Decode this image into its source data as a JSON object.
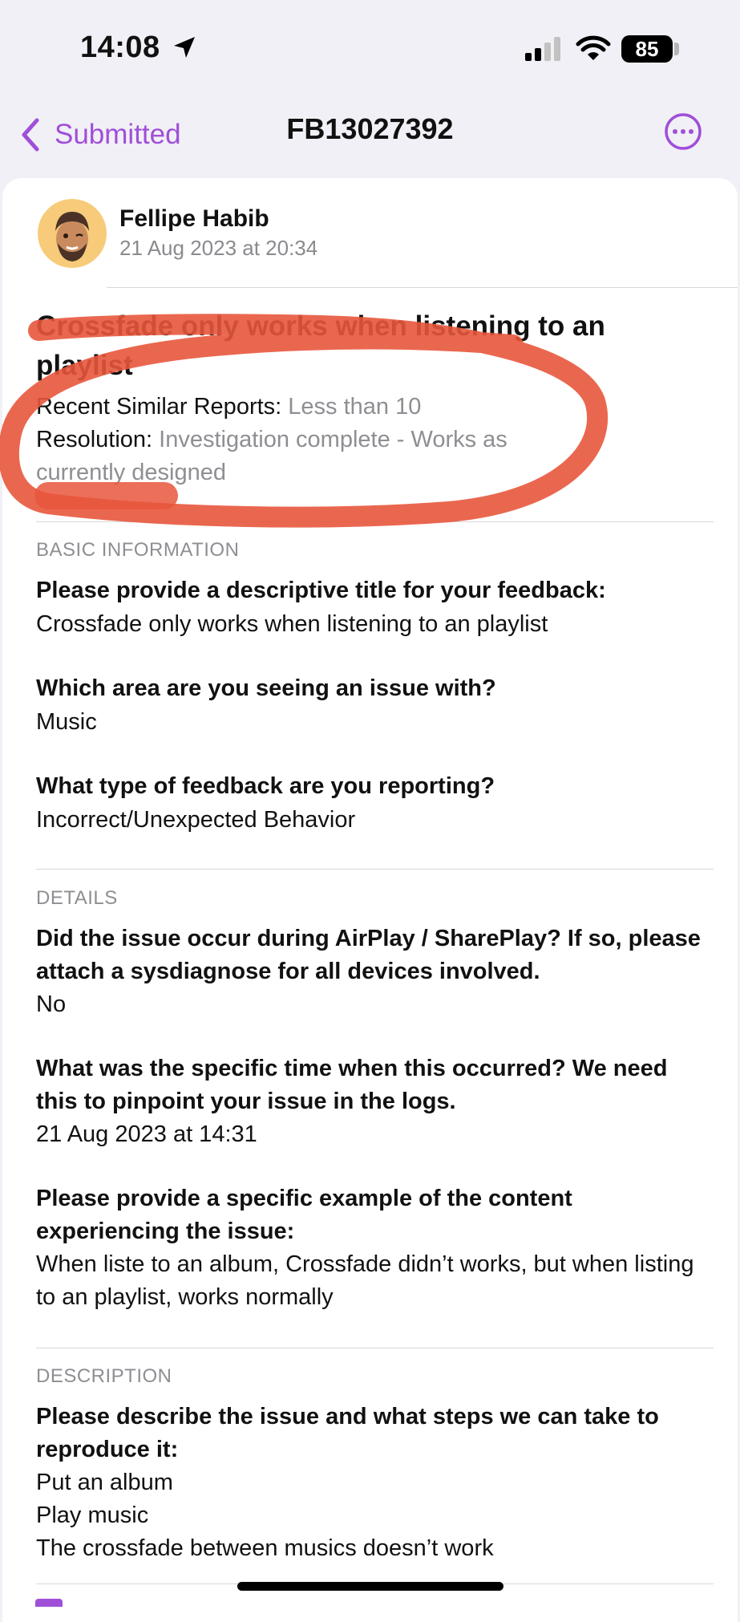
{
  "status_bar": {
    "time": "14:08",
    "battery": "85"
  },
  "nav": {
    "back_label": "Submitted",
    "title": "FB13027392"
  },
  "author": {
    "name": "Fellipe Habib",
    "date": "21 Aug 2023 at 20:34"
  },
  "report": {
    "title": "Crossfade only works when listening to an playlist",
    "similar_label": "Recent Similar Reports:",
    "similar_value": "Less than 10",
    "resolution_label": "Resolution:",
    "resolution_value": "Investigation complete - Works as currently designed"
  },
  "basic": {
    "header": "BASIC INFORMATION",
    "q1": "Please provide a descriptive title for your feedback:",
    "a1": "Crossfade only works when listening to an playlist",
    "q2": "Which area are you seeing an issue with?",
    "a2": "Music",
    "q3": "What type of feedback are you reporting?",
    "a3": "Incorrect/Unexpected Behavior"
  },
  "details": {
    "header": "DETAILS",
    "q1": "Did the issue occur during AirPlay / SharePlay? If so, please attach a sysdiagnose for all devices involved.",
    "a1": "No",
    "q2": "What was the specific time when this occurred? We need this to pinpoint your issue in the logs.",
    "a2": "21 Aug 2023 at 14:31",
    "q3": "Please provide a specific example of the content experiencing the issue:",
    "a3": "When liste to an album, Crossfade didn’t works, but when listing to an playlist, works normally"
  },
  "description": {
    "header": "DESCRIPTION",
    "q1": "Please describe the issue and what steps we can take to reproduce it:",
    "line1": "Put an album",
    "line2": "Play music",
    "line3": "The crossfade between musics doesn’t work"
  },
  "icons": {
    "location": "location-arrow-icon",
    "signal": "cellular-signal-icon",
    "wifi": "wifi-icon",
    "back": "chevron-left-icon",
    "more": "ellipsis-circle-icon"
  },
  "colors": {
    "accent": "#a04fd8",
    "annotation": "#e8563c",
    "secondary_text": "#8e8e93"
  }
}
